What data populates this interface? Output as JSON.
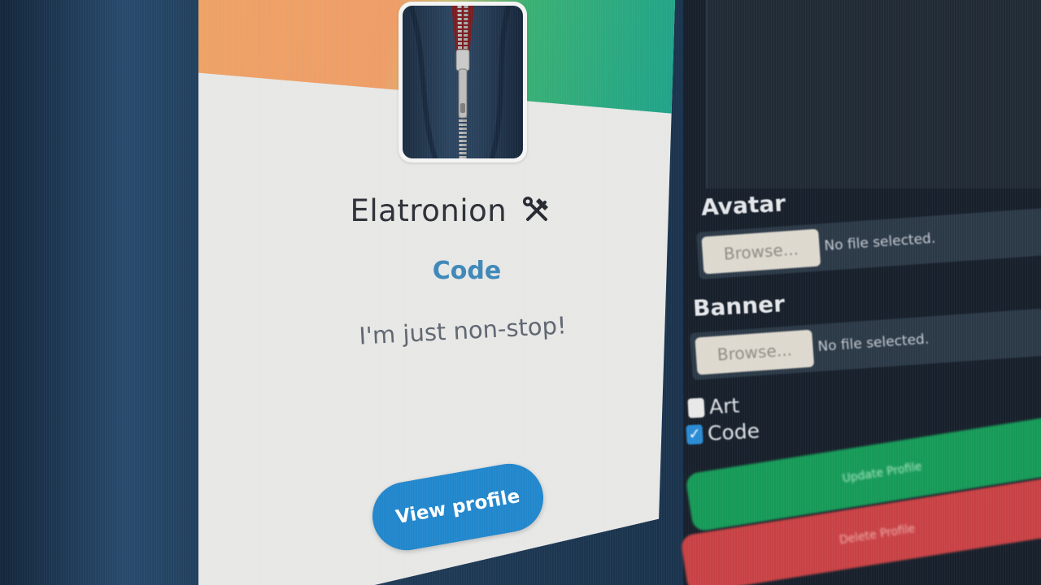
{
  "profile_card": {
    "username": "Elatronion",
    "username_icon": "hammer-wrench-icon",
    "category": "Code",
    "bio": "I'm just non-stop!",
    "view_profile_label": "View profile",
    "banner_colors": [
      "#eda266",
      "#3bb073",
      "#1fa38a"
    ],
    "avatar_icon": "zipper-jacket-image"
  },
  "edit_form": {
    "avatar": {
      "label": "Avatar",
      "browse_label": "Browse...",
      "status": "No file selected."
    },
    "banner": {
      "label": "Banner",
      "browse_label": "Browse...",
      "status": "No file selected."
    },
    "categories": [
      {
        "label": "Art",
        "checked": false
      },
      {
        "label": "Code",
        "checked": true
      }
    ],
    "update_label": "Update Profile",
    "delete_label": "Delete Profile"
  },
  "colors": {
    "accent_blue": "#2287cc",
    "category_text": "#3e88b8",
    "update_green": "#179a58",
    "delete_red": "#c84245",
    "panel_bg": "#17202b"
  }
}
